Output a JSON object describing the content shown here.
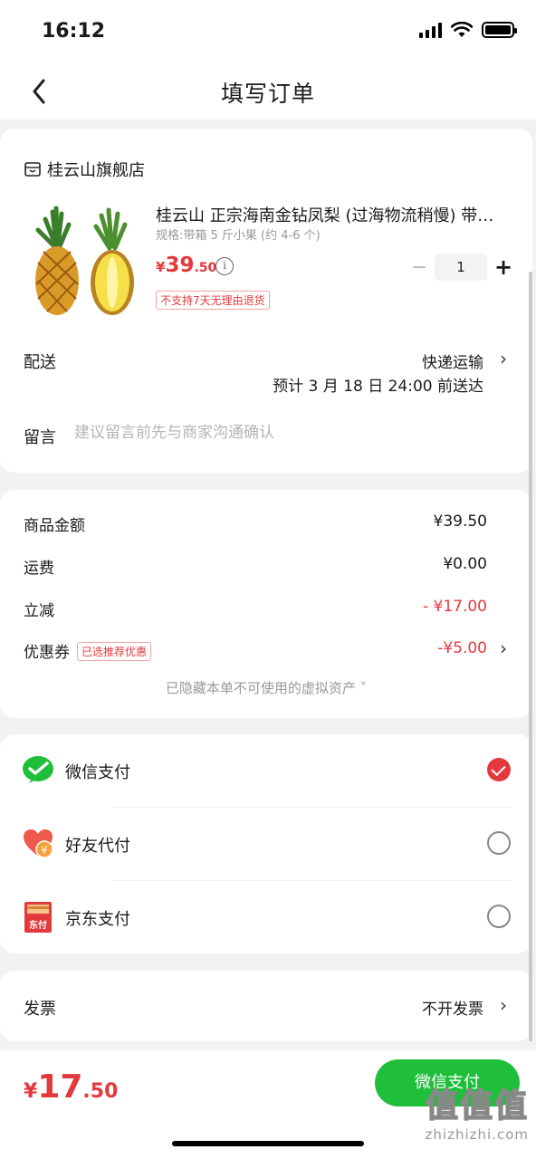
{
  "status_bar": {
    "time": "16:12"
  },
  "nav": {
    "title": "填写订单"
  },
  "shop": {
    "name": "桂云山旗舰店"
  },
  "product": {
    "title": "桂云山 正宗海南金钻凤梨 (过海物流稍慢) 带…",
    "spec": "规格:带箱 5 斤小果 (约 4-6 个)",
    "price_symbol": "¥",
    "price_int": "39",
    "price_dec": ".50",
    "quantity": "1",
    "return_policy": "不支持7天无理由退货"
  },
  "delivery": {
    "label": "配送",
    "method": "快递运输",
    "eta": "预计 3 月 18 日 24:00 前送达"
  },
  "message": {
    "label": "留言",
    "placeholder": "建议留言前先与商家沟通确认"
  },
  "amounts": {
    "goods_label": "商品金额",
    "goods_value": "¥39.50",
    "shipping_label": "运费",
    "shipping_value": "¥0.00",
    "discount_label": "立减",
    "discount_value": "- ¥17.00",
    "coupon_label": "优惠券",
    "coupon_badge": "已选推荐优惠",
    "coupon_value": "-¥5.00",
    "hidden_assets": "已隐藏本单不可使用的虚拟资产 ˅"
  },
  "payment": {
    "options": [
      {
        "label": "微信支付",
        "icon": "wechat-pay-icon",
        "selected": true
      },
      {
        "label": "好友代付",
        "icon": "friend-pay-icon",
        "selected": false
      },
      {
        "label": "京东支付",
        "icon": "jd-pay-icon",
        "selected": false
      }
    ],
    "jd_icon_text": "东付",
    "friend_icon_text": "¥"
  },
  "invoice": {
    "label": "发票",
    "value": "不开发票"
  },
  "bottom": {
    "total_symbol": "¥",
    "total_int": "17",
    "total_dec": ".50",
    "pay_button": "微信支付",
    "watermark_logo": "值值值",
    "watermark_url": "zhizhizhi.com"
  },
  "colors": {
    "accent_red": "#e4393c",
    "wechat_green": "#1fbf3b"
  }
}
